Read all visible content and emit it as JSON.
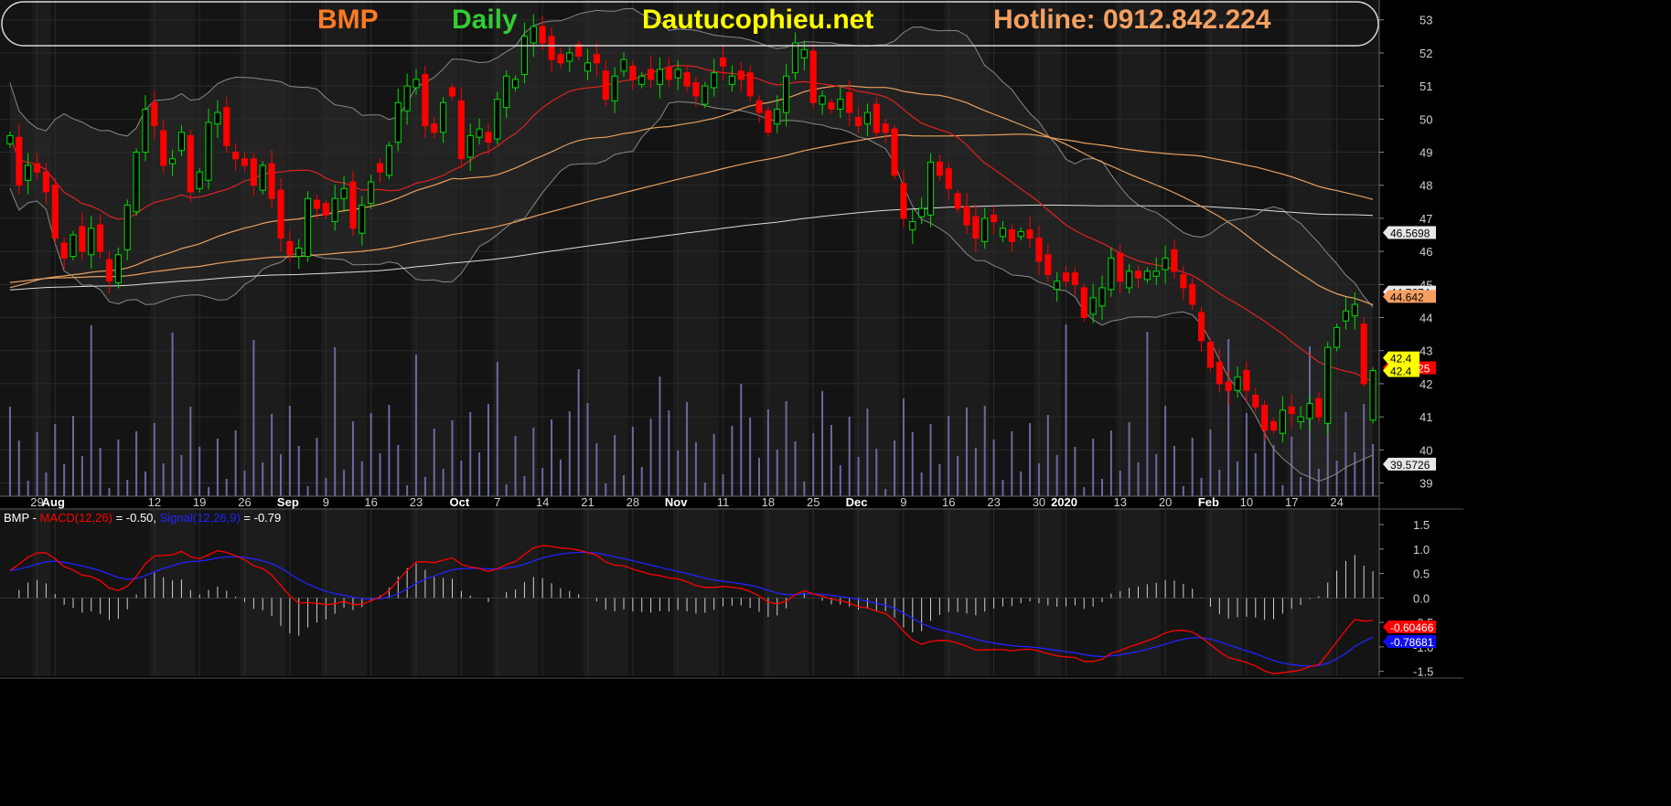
{
  "header": {
    "symbol": "BMP",
    "period": "Daily",
    "site": "Dautucophieu.net",
    "hotline": "Hotline: 0912.842.224"
  },
  "colors": {
    "background": "#000000",
    "up": "#00dd00",
    "down": "#ff0000",
    "symbol": "#ff7a22",
    "period": "#33cc33",
    "site": "#ffff00",
    "hotline": "#f5a060",
    "ma20": "#dd2222",
    "ma50": "#e8a060",
    "ma100": "#e8a060",
    "ma200": "#dddddd",
    "bollinger": "#888888",
    "volume": "#6a6aa0",
    "macd": "#ff0000",
    "signal": "#2222ff"
  },
  "chart_data": [
    {
      "type": "candlestick",
      "ylim": [
        38.6,
        53.6
      ],
      "y_ticks": [
        39,
        40,
        41,
        42,
        43,
        44,
        45,
        46,
        47,
        48,
        49,
        50,
        51,
        52,
        53
      ],
      "x_labels": [
        {
          "i": 3,
          "label": "29"
        },
        {
          "i": 5,
          "label": "Aug"
        },
        {
          "i": 16,
          "label": "12"
        },
        {
          "i": 21,
          "label": "19"
        },
        {
          "i": 26,
          "label": "26"
        },
        {
          "i": 31,
          "label": "Sep"
        },
        {
          "i": 35,
          "label": "9"
        },
        {
          "i": 40,
          "label": "16"
        },
        {
          "i": 45,
          "label": "23"
        },
        {
          "i": 50,
          "label": "Oct"
        },
        {
          "i": 54,
          "label": "7"
        },
        {
          "i": 59,
          "label": "14"
        },
        {
          "i": 64,
          "label": "21"
        },
        {
          "i": 69,
          "label": "28"
        },
        {
          "i": 74,
          "label": "Nov"
        },
        {
          "i": 79,
          "label": "11"
        },
        {
          "i": 84,
          "label": "18"
        },
        {
          "i": 89,
          "label": "25"
        },
        {
          "i": 94,
          "label": "Dec"
        },
        {
          "i": 99,
          "label": "9"
        },
        {
          "i": 104,
          "label": "16"
        },
        {
          "i": 109,
          "label": "23"
        },
        {
          "i": 114,
          "label": "30"
        },
        {
          "i": 117,
          "label": "2020"
        },
        {
          "i": 123,
          "label": "13"
        },
        {
          "i": 128,
          "label": "20"
        },
        {
          "i": 133,
          "label": "Feb"
        },
        {
          "i": 137,
          "label": "10"
        },
        {
          "i": 142,
          "label": "17"
        },
        {
          "i": 147,
          "label": "24"
        }
      ],
      "price_labels": [
        {
          "value": "46.5698",
          "y": 46.57,
          "bg": "#e8e8e8",
          "fg": "#000000"
        },
        {
          "value": "44.7674",
          "y": 44.77,
          "bg": "#e8e8e8",
          "fg": "#000000"
        },
        {
          "value": "44.642",
          "y": 44.64,
          "bg": "#f5a060",
          "fg": "#000000"
        },
        {
          "value": "42.4825",
          "y": 42.48,
          "bg": "#ff0000",
          "fg": "#ffffff"
        },
        {
          "value": "42.4",
          "y": 42.78,
          "bg": "#ffff00",
          "fg": "#000000"
        },
        {
          "value": "42.4",
          "y": 42.4,
          "bg": "#ffff00",
          "fg": "#000000"
        },
        {
          "value": "39.5726",
          "y": 39.57,
          "bg": "#e8e8e8",
          "fg": "#000000"
        }
      ],
      "closes": [
        49.5,
        48,
        48.6,
        48.4,
        47.8,
        46.4,
        45.8,
        46.5,
        46,
        46.7,
        46,
        45.1,
        45.9,
        47.4,
        49,
        50.3,
        49.8,
        48.6,
        48.8,
        49.6,
        47.8,
        48.4,
        49.9,
        50.2,
        49.2,
        48.8,
        48.6,
        48,
        48.6,
        47.6,
        46.4,
        45.9,
        46.1,
        47.6,
        47.3,
        47.1,
        47.6,
        47.9,
        46.7,
        47.4,
        48.1,
        48.4,
        49.2,
        50.5,
        51,
        51.2,
        49.8,
        49.6,
        50.5,
        50.7,
        48.8,
        49.5,
        49.7,
        49.3,
        50.6,
        51.3,
        51.2,
        52.5,
        52.8,
        52.3,
        51.8,
        51.7,
        52,
        51.9,
        51.7,
        51.7,
        50.6,
        51.3,
        51.8,
        51.2,
        51.3,
        51.2,
        51.5,
        51.2,
        51.5,
        51,
        50.7,
        51,
        51.4,
        51.6,
        51.3,
        51.2,
        50.7,
        50.2,
        49.6,
        50.3,
        51.3,
        52.3,
        52.1,
        50.5,
        50.7,
        50.3,
        50.6,
        50.2,
        49.8,
        50.2,
        49.6,
        49.6,
        48.3,
        47,
        46.9,
        47.3,
        48.7,
        48.3,
        47.9,
        47.3,
        46.8,
        46.4,
        47,
        46.9,
        46.7,
        46.3,
        46.6,
        46.4,
        45.7,
        45.3,
        45.1,
        45.1,
        45,
        44,
        44.6,
        44.9,
        45.8,
        45.1,
        45.4,
        45.2,
        45.4,
        45.4,
        45.8,
        45.4,
        44.9,
        44.4,
        43.3,
        42.5,
        42,
        41.8,
        42.2,
        41.8,
        41.3,
        40.6,
        40.6,
        41.2,
        41.1,
        41,
        41.4,
        41,
        43.1,
        43.7,
        44.2,
        44.4,
        42,
        41.5
      ]
    },
    {
      "type": "line",
      "series": [
        {
          "name": "MACD(12,26)",
          "value": "-0.50",
          "tag": "-0.60466",
          "tag_bg": "#ff0000"
        },
        {
          "name": "Signal(12,26,9)",
          "value": "-0.79",
          "tag": "-0.78681",
          "tag_bg": "#1010ee"
        }
      ],
      "ylim": [
        -1.6,
        1.8
      ],
      "y_ticks": [
        {
          "v": 1.5,
          "label": "1.5"
        },
        {
          "v": 1.0,
          "label": "1.0"
        },
        {
          "v": 0.5,
          "label": "0.5"
        },
        {
          "v": 0.0,
          "label": "0.0"
        },
        {
          "v": -0.5,
          "label": "-0.5"
        },
        {
          "v": -1.0,
          "label": "-1.0"
        },
        {
          "v": -1.5,
          "label": "-1.5"
        }
      ]
    }
  ]
}
